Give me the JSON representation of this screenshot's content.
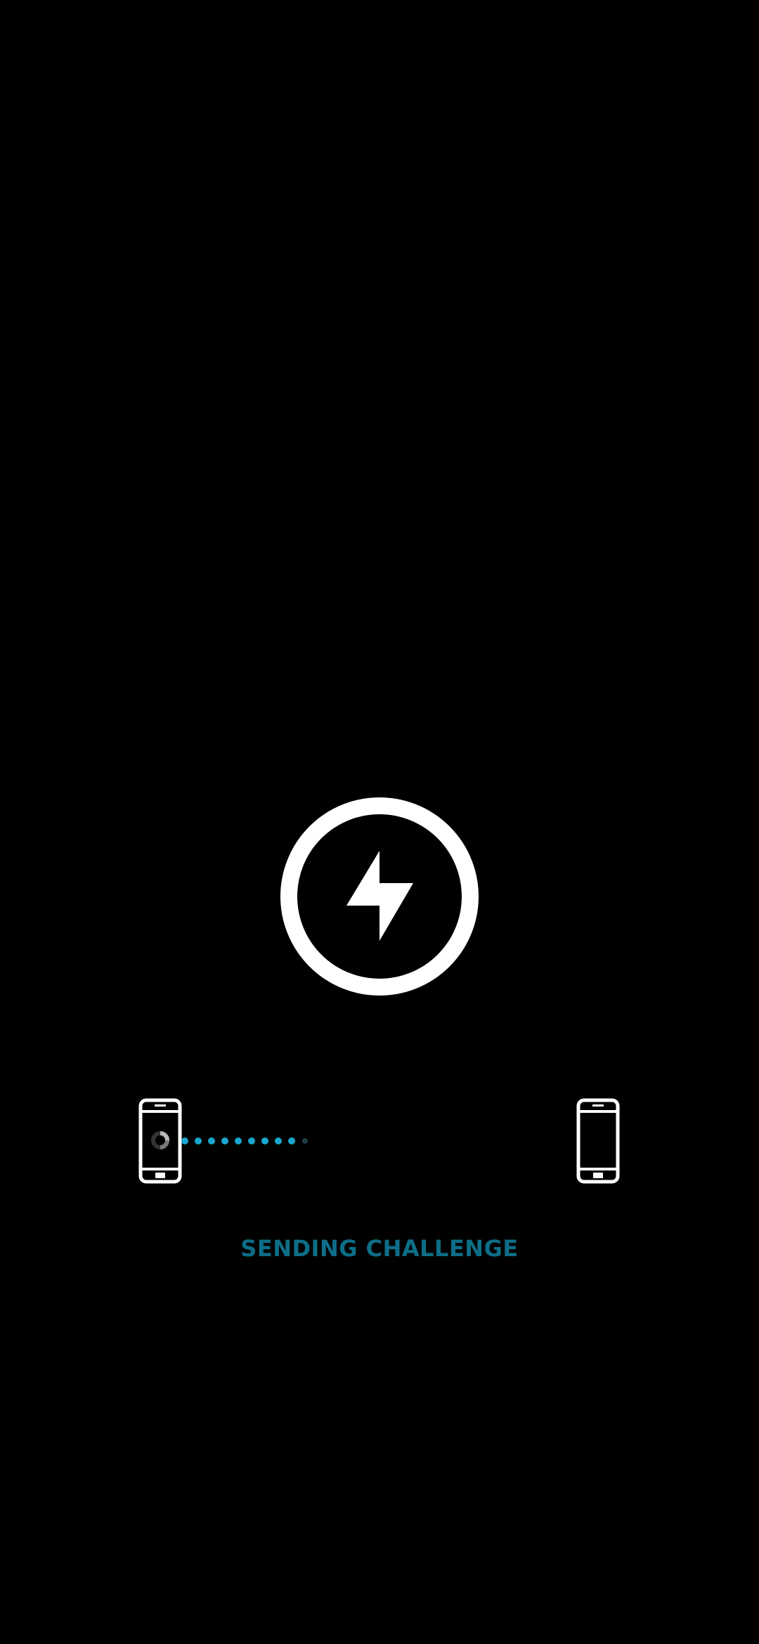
{
  "status": {
    "text": "SENDING CHALLENGE"
  },
  "icons": {
    "center": "lightning-bolt-icon",
    "sender": "phone-icon",
    "receiver": "phone-icon",
    "progress": "loading-spinner-icon"
  },
  "transfer": {
    "dots_total": 10,
    "dots_active": 9
  },
  "colors": {
    "background": "#000000",
    "icon": "#ffffff",
    "accent": "#1aa7cf",
    "status_text": "#0e6e88",
    "inactive_dot": "#1c3e49"
  }
}
